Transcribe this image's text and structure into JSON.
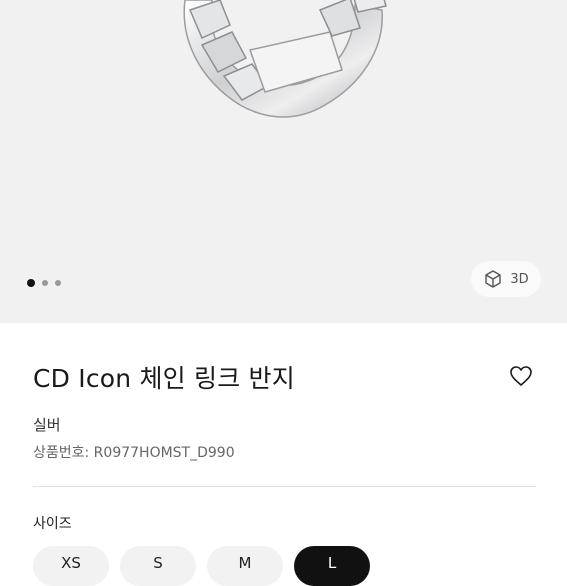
{
  "gallery": {
    "image_alt": "CD Icon chain link ring",
    "slide_count": 3,
    "active_slide": 1,
    "view_3d_label": "3D",
    "view_3d_icon": "cube-icon"
  },
  "product": {
    "title": "CD Icon 체인 링크 반지",
    "color": "실버",
    "code_label": "상품번호: R0977HOMST_D990",
    "wishlist_icon": "heart-icon"
  },
  "size_selector": {
    "label": "사이즈",
    "options": [
      "XS",
      "S",
      "M",
      "L"
    ],
    "selected": "L"
  },
  "colors": {
    "gallery_bg": "#f1f1f2",
    "selected_size_bg": "#111111",
    "unselected_size_bg": "#f2f2f2"
  }
}
